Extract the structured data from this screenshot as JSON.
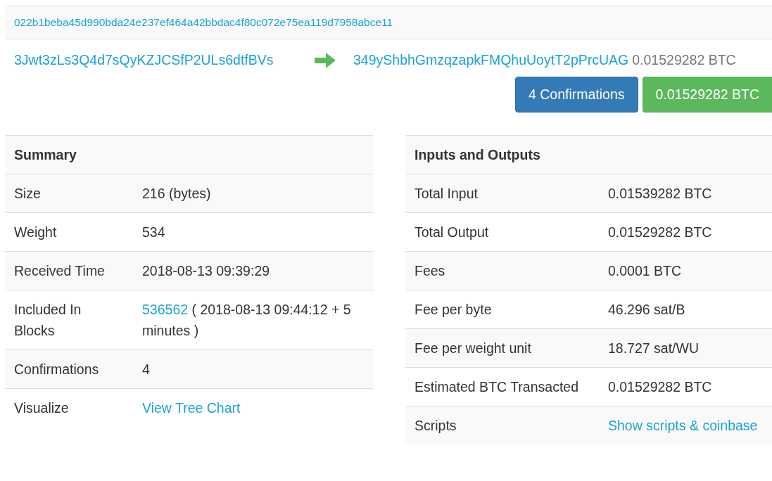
{
  "transaction": {
    "hash": "022b1beba45d990bda24e237ef464a42bbdac4f80c072e75ea119d7958abce11",
    "from_address": "3Jwt3zLs3Q4d7sQyKZJCSfP2ULs6dtfBVs",
    "to_address": "349yShbhGmzqzapkFMQhuUoytT2pPrcUAG",
    "to_amount": "0.01529282 BTC",
    "confirmations_button": "4 Confirmations",
    "amount_button": "0.01529282 BTC"
  },
  "summary": {
    "title": "Summary",
    "rows": [
      {
        "label": "Size",
        "value": "216 (bytes)"
      },
      {
        "label": "Weight",
        "value": "534"
      },
      {
        "label": "Received Time",
        "value": "2018-08-13 09:39:29"
      },
      {
        "label": "Included In Blocks",
        "link": "536562",
        "value": "( 2018-08-13 09:44:12 + 5 minutes )"
      },
      {
        "label": "Confirmations",
        "value": "4"
      },
      {
        "label": "Visualize",
        "link": "View Tree Chart"
      }
    ]
  },
  "inputs_outputs": {
    "title": "Inputs and Outputs",
    "rows": [
      {
        "label": "Total Input",
        "value": "0.01539282 BTC"
      },
      {
        "label": "Total Output",
        "value": "0.01529282 BTC"
      },
      {
        "label": "Fees",
        "value": "0.0001 BTC"
      },
      {
        "label": "Fee per byte",
        "value": "46.296 sat/B"
      },
      {
        "label": "Fee per weight unit",
        "value": "18.727 sat/WU"
      },
      {
        "label": "Estimated BTC Transacted",
        "value": "0.01529282 BTC"
      },
      {
        "label": "Scripts",
        "link": "Show scripts & coinbase"
      }
    ]
  }
}
